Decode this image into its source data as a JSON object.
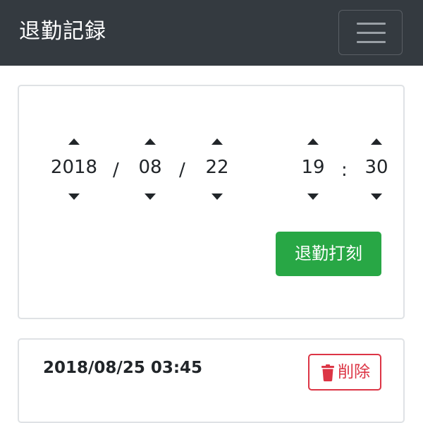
{
  "header": {
    "title": "退勤記録",
    "menu_icon": "hamburger-icon"
  },
  "picker": {
    "year": "2018",
    "month": "08",
    "day": "22",
    "hour": "19",
    "minute": "30",
    "date_separator": "/",
    "time_separator": ":",
    "submit_label": "退勤打刻"
  },
  "records": [
    {
      "datetime": "2018/08/25 03:45",
      "delete_label": "削除",
      "delete_icon": "trash-icon"
    }
  ],
  "colors": {
    "navbar": "#343a40",
    "success": "#28a745",
    "danger": "#dc3545"
  }
}
